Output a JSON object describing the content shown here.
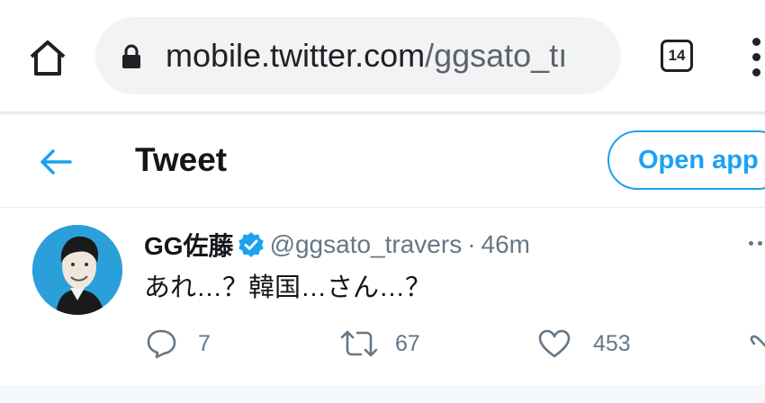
{
  "browser": {
    "url_host": "mobile.twitter.com",
    "url_path": "/ggsato_tı",
    "tab_count": "14"
  },
  "header": {
    "title": "Tweet",
    "open_app_label": "Open app"
  },
  "tweet": {
    "display_name": "GG佐藤",
    "handle": "@ggsato_travers",
    "separator": "·",
    "time": "46m",
    "text": "あれ…？韓国…さん…？",
    "replies": "7",
    "retweets": "67",
    "likes": "453"
  },
  "colors": {
    "accent": "#1da1f2",
    "secondary_text": "#657786",
    "url_bar": "#f1f3f4"
  }
}
